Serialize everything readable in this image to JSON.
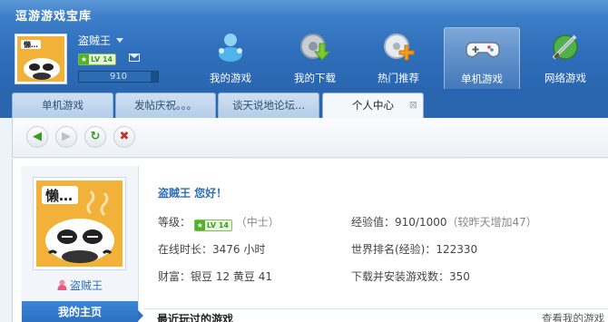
{
  "app": {
    "title": "逗游游戏宝库"
  },
  "user": {
    "name": "盗贼王",
    "level": "LV 14",
    "exp_display": "910",
    "exp_fraction": 0.91
  },
  "nav": [
    {
      "label": "我的游戏",
      "icon": "my-games-icon"
    },
    {
      "label": "我的下载",
      "icon": "download-icon"
    },
    {
      "label": "热门推荐",
      "icon": "hot-recommend-icon"
    },
    {
      "label": "单机游戏",
      "icon": "gamepad-icon",
      "active": true
    },
    {
      "label": "网络游戏",
      "icon": "online-game-icon"
    }
  ],
  "tabs": [
    {
      "label": "单机游戏"
    },
    {
      "label": "发帖庆祝。。。"
    },
    {
      "label": "谈天说地论坛..."
    },
    {
      "label": "个人中心",
      "active": true
    }
  ],
  "toolbar": {
    "back": "back-icon",
    "forward": "forward-icon",
    "refresh": "refresh-icon",
    "stop": "stop-icon"
  },
  "profile": {
    "name": "盗贼王",
    "home_tab": "我的主页",
    "greeting": "盗贼王 您好！",
    "level_label": "等级：",
    "level_badge": "LV 14",
    "level_rank": "（中士）",
    "exp_label": "经验值：910/1000",
    "exp_delta": "（较昨天增加47）",
    "online_time": "在线时长：3476 小时",
    "world_rank": "世界排名(经验)：122330",
    "wealth": "财富：银豆 12  黄豆 41",
    "downloads": "下载并安装游戏数：350"
  },
  "recent": {
    "title": "最近玩过的游戏",
    "view_all": "查看我的游戏"
  },
  "colors": {
    "header_blue": "#2f6fbb",
    "link_blue": "#2e6db5",
    "level_green": "#55b02b"
  }
}
